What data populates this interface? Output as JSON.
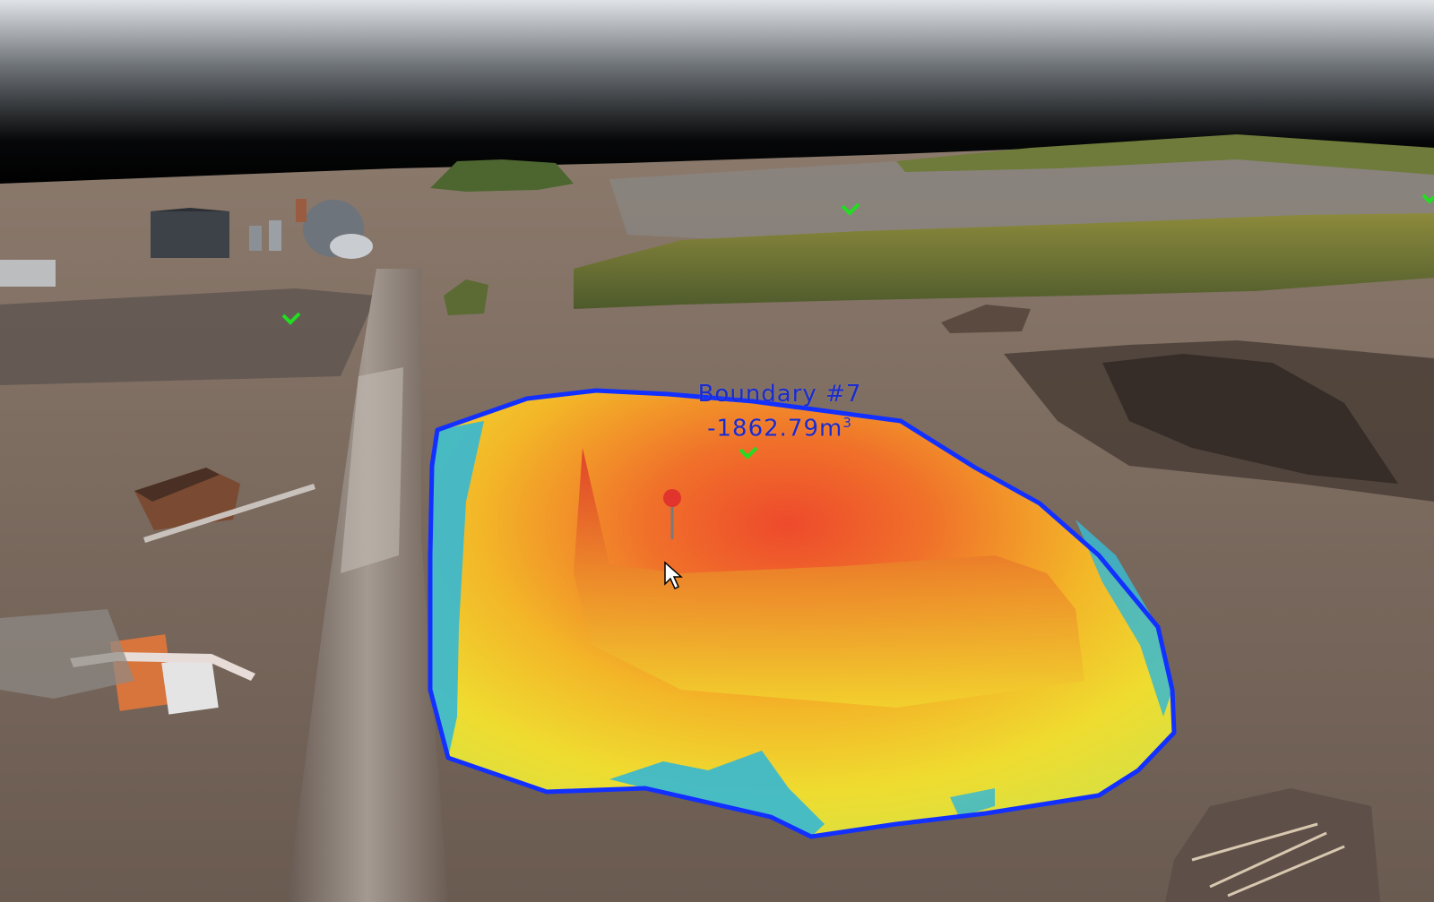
{
  "measurement": {
    "name": "Boundary #7",
    "volume_value": "-1862.79",
    "volume_unit": "m",
    "volume_unit_exponent": "3"
  },
  "colors": {
    "boundary_line": "#1230ff",
    "label_text": "#1a2bd0",
    "marker_pin": "#e0342c",
    "control_point": "#22dd22",
    "heat_low": "#3cc3d8",
    "heat_mid": "#f2e02c",
    "heat_high": "#e5322a"
  },
  "icons": [
    "map-pin-icon",
    "control-point-marker-icon",
    "mouse-cursor-icon"
  ]
}
